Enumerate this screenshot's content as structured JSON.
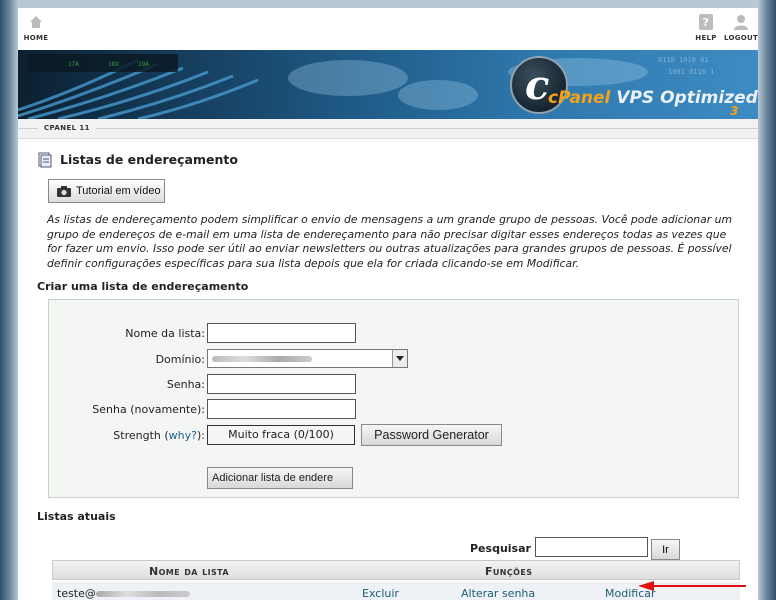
{
  "nav": {
    "home": "HOME",
    "help": "HELP",
    "logout": "LOGOUT"
  },
  "banner": {
    "brand_c": "c",
    "brand_cpanel": "cPanel",
    "brand_vps": " VPS Optimized",
    "brand_version": "3"
  },
  "breadcrumb": "CPANEL 11",
  "page": {
    "title": "Listas de endereçamento",
    "tutorial_label": "Tutorial em vídeo",
    "intro": "As listas de endereçamento podem simplificar o envio de mensagens a um grande grupo de pessoas. Você pode adicionar um grupo de endereços de e-mail em uma lista de endereçamento para não precisar digitar esses endereços todas as vezes que for fazer um envio. Isso pode ser útil ao enviar newsletters ou outras atualizações para grandes grupos de pessoas. É possível definir configurações específicas para sua lista depois que ela for criada clicando-se em Modificar."
  },
  "create": {
    "heading": "Criar uma lista de endereçamento",
    "list_name_label": "Nome da lista:",
    "list_name_value": "",
    "domain_label": "Domínio:",
    "password_label": "Senha:",
    "password_again_label": "Senha (novamente):",
    "strength_label": "Strength (",
    "strength_why": "why?",
    "strength_close": "):",
    "strength_value": "Muito fraca (0/100)",
    "pwgen_label": "Password Generator",
    "submit_label": "Adicionar lista de endere"
  },
  "current": {
    "heading": "Listas atuais",
    "search_label": "Pesquisar",
    "search_value": "",
    "search_button": "Ir",
    "col_name": "Nome da lista",
    "col_functions": "Funções",
    "rows": [
      {
        "name_prefix": "teste@",
        "action_delete": "Excluir",
        "action_password": "Alterar senha",
        "action_modify": "Modificar"
      }
    ]
  },
  "colors": {
    "link": "#1d5c77",
    "annotation_arrow": "#e01010"
  }
}
